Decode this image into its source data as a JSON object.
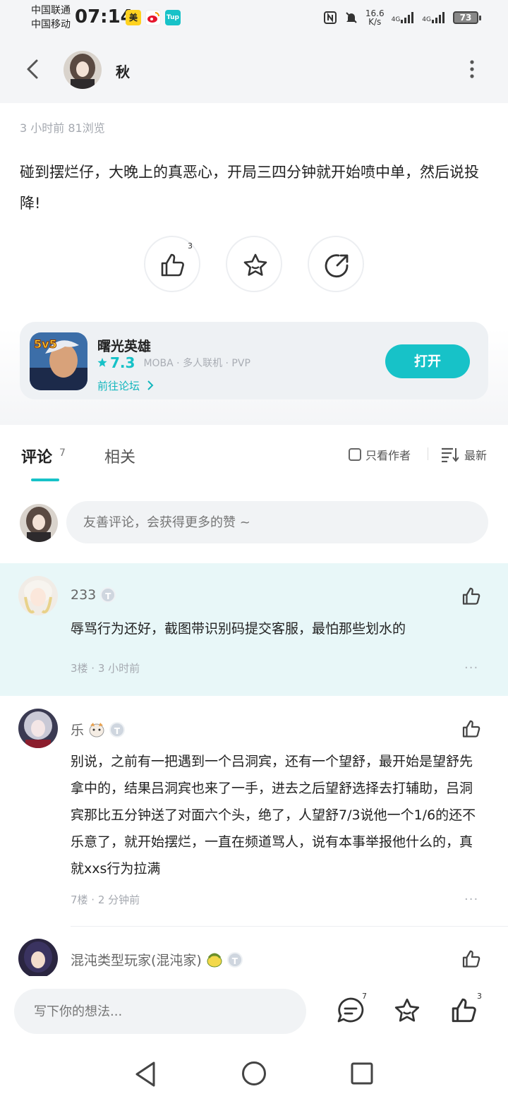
{
  "status_bar": {
    "carrier1": "中国联通",
    "carrier2": "中国移动",
    "time": "07:14",
    "app_badges": [
      "美",
      "Tup"
    ],
    "net_speed_value": "16.6",
    "net_speed_unit": "K/s",
    "signal1": "4G",
    "signal2": "4G",
    "battery": "73"
  },
  "header": {
    "author_name": "秋"
  },
  "post": {
    "meta": "3 小时前   81浏览",
    "body": "碰到摆烂仔，大晚上的真恶心，开局三四分钟就开始喷中单，然后说投降!",
    "like_count": "3"
  },
  "game": {
    "name": "曙光英雄",
    "rating": "7.3",
    "tags": "MOBA · 多人联机 · PVP",
    "forum_link": "前往论坛",
    "open_label": "打开",
    "icon_text": "5v5"
  },
  "tabs": {
    "comments_label": "评论",
    "comments_count": "7",
    "related_label": "相关",
    "only_author_label": "只看作者",
    "sort_label": "最新"
  },
  "compose": {
    "placeholder": "友善评论，会获得更多的赞 ~"
  },
  "comments": [
    {
      "name": "233",
      "text": "辱骂行为还好，截图带识别码提交客服，最怕那些划水的",
      "meta": "3楼 · 3 小时前",
      "more": "···"
    },
    {
      "name": "乐",
      "text": "别说，之前有一把遇到一个吕洞宾，还有一个望舒，最开始是望舒先拿中的，结果吕洞宾也来了一手，进去之后望舒选择去打辅助，吕洞宾那比五分钟送了对面六个头，绝了，人望舒7/3说他一个1/6的还不乐意了，就开始摆烂，一直在频道骂人，说有本事举报他什么的，真就xxs行为拉满",
      "meta": "7楼 · 2 分钟前",
      "more": "···"
    },
    {
      "name": "混沌类型玩家(混沌家)"
    }
  ],
  "bottom_bar": {
    "placeholder": "写下你的想法...",
    "comment_count": "7",
    "like_count": "3"
  },
  "colors": {
    "accent": "#17c2c8",
    "highlight_bg": "#e8f7f8",
    "page_bg": "#f4f5f7"
  }
}
